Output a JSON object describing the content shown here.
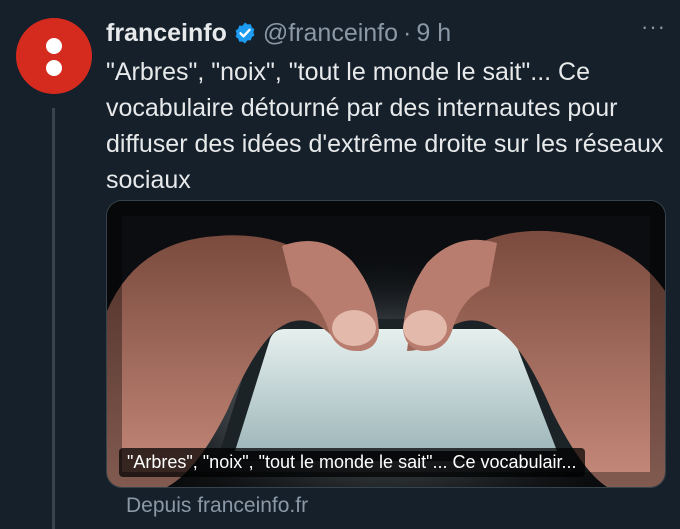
{
  "tweet": {
    "author_name": "franceinfo",
    "handle": "@franceinfo",
    "separator": "·",
    "time": "9 h",
    "more_label": "···",
    "text": "\"Arbres\", \"noix\", \"tout le monde le sait\"... Ce vocabulaire détourné par des internautes pour diffuser des idées d'extrême droite sur les réseaux sociaux"
  },
  "card": {
    "title": "\"Arbres\", \"noix\", \"tout le monde le sait\"... Ce vocabulair...",
    "source": "Depuis franceinfo.fr"
  },
  "icons": {
    "avatar": "franceinfo-logo",
    "verified": "verified-badge-icon",
    "more": "more-options-icon"
  },
  "colors": {
    "background": "#15202b",
    "brand_red": "#d52b1e",
    "verified_blue": "#1d9bf0",
    "secondary_text": "#8b98a5"
  }
}
